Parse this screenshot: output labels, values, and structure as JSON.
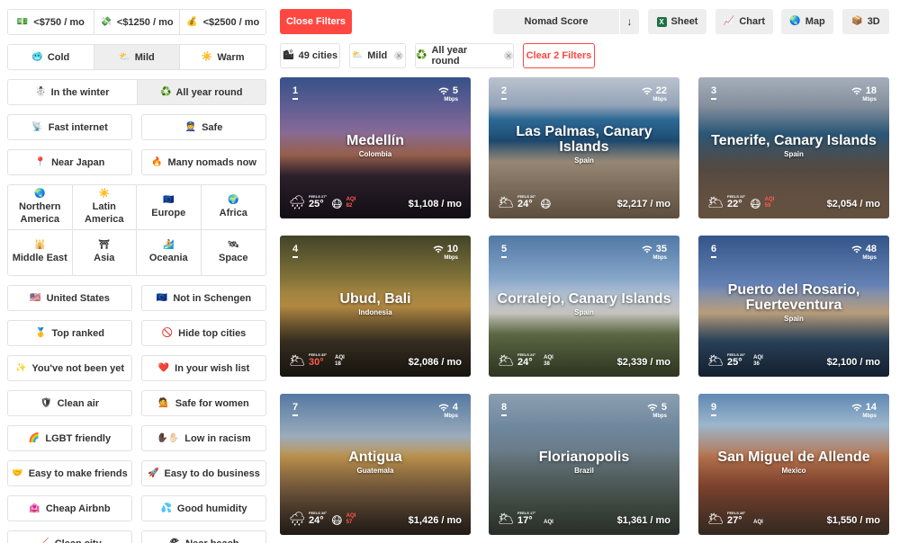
{
  "sidebar": {
    "budget": [
      {
        "icon": "💵",
        "label": "<$750 / mo"
      },
      {
        "icon": "💸",
        "label": "<$1250 / mo"
      },
      {
        "icon": "💰",
        "label": "<$2500 / mo"
      }
    ],
    "climate": [
      {
        "icon": "🥶",
        "label": "Cold"
      },
      {
        "icon": "⛅",
        "label": "Mild"
      },
      {
        "icon": "☀️",
        "label": "Warm"
      }
    ],
    "season": [
      {
        "icon": "☃️",
        "label": "In the winter"
      },
      {
        "icon": "♻️",
        "label": "All year round"
      }
    ],
    "toggles_a": [
      {
        "icon": "📡",
        "label": "Fast internet"
      },
      {
        "icon": "👮",
        "label": "Safe"
      },
      {
        "icon": "📍",
        "label": "Near Japan"
      },
      {
        "icon": "🔥",
        "label": "Many nomads now"
      }
    ],
    "regions": [
      {
        "icon": "🌏",
        "label": "Northern America"
      },
      {
        "icon": "☀️",
        "label": "Latin America"
      },
      {
        "icon": "🇪🇺",
        "label": "Europe"
      },
      {
        "icon": "🌍",
        "label": "Africa"
      },
      {
        "icon": "🕌",
        "label": "Middle East"
      },
      {
        "icon": "⛩",
        "label": "Asia"
      },
      {
        "icon": "🏄",
        "label": "Oceania"
      },
      {
        "icon": "🛰",
        "label": "Space"
      }
    ],
    "toggles_b": [
      {
        "icon": "🇺🇸",
        "label": "United States"
      },
      {
        "icon": "🇪🇺",
        "label": "Not in Schengen"
      },
      {
        "icon": "🥇",
        "label": "Top ranked"
      },
      {
        "icon": "🚫",
        "label": "Hide top cities"
      },
      {
        "icon": "✨",
        "label": "You've not been yet"
      },
      {
        "icon": "❤️",
        "label": "In your wish list"
      },
      {
        "icon": "🛡",
        "label": "Clean air"
      },
      {
        "icon": "💁",
        "label": "Safe for women"
      },
      {
        "icon": "🌈",
        "label": "LGBT friendly"
      },
      {
        "icon": "✋🏿✋🏻",
        "label": "Low in racism"
      },
      {
        "icon": "🤝",
        "label": "Easy to make friends"
      },
      {
        "icon": "🚀",
        "label": "Easy to do business"
      },
      {
        "icon": "🏩",
        "label": "Cheap Airbnb"
      },
      {
        "icon": "💦",
        "label": "Good humidity"
      },
      {
        "icon": "🧹",
        "label": "Clean city"
      },
      {
        "icon": "🏖",
        "label": "Near beach"
      }
    ]
  },
  "topbar": {
    "close_filters": "Close Filters",
    "sort_value": "Nomad Score",
    "sort_dir": "↓",
    "sheet": "Sheet",
    "chart": "Chart",
    "map": "Map",
    "three_d": "3D",
    "chart_icon": "📈",
    "map_icon": "🌏",
    "three_d_icon": "📦"
  },
  "active_filters": {
    "count": {
      "icon": "🏙",
      "label": "49 cities"
    },
    "mild": {
      "icon": "⛅",
      "label": "Mild"
    },
    "all_year": {
      "icon": "♻️",
      "label": "All year round"
    },
    "clear": "Clear 2 Filters"
  },
  "cities": [
    {
      "rank": "1",
      "name": "Medellín",
      "country": "Colombia",
      "speed": "5",
      "unit": "Mbps",
      "weather": "🌧",
      "feels": "FEELS 27°",
      "temp": "25°",
      "aqi_face": "😷",
      "aqi_label": "AQI",
      "aqi": "82",
      "aqi_bad": true,
      "temp_hot": false,
      "cost": "$1,108 / mo"
    },
    {
      "rank": "2",
      "name": "Las Palmas, Canary Islands",
      "country": "Spain",
      "speed": "22",
      "unit": "Mbps",
      "weather": "🌥",
      "feels": "FEELS 26°",
      "temp": "24°",
      "aqi_face": "😷",
      "aqi_label": "",
      "aqi": "",
      "aqi_bad": false,
      "temp_hot": false,
      "cost": "$2,217 / mo"
    },
    {
      "rank": "3",
      "name": "Tenerife, Canary Islands",
      "country": "Spain",
      "speed": "18",
      "unit": "Mbps",
      "weather": "🌥",
      "feels": "FEELS 23°",
      "temp": "22°",
      "aqi_face": "😷",
      "aqi_label": "AQI",
      "aqi": "59",
      "aqi_bad": true,
      "temp_hot": false,
      "cost": "$2,054 / mo"
    },
    {
      "rank": "4",
      "name": "Ubud, Bali",
      "country": "Indonesia",
      "speed": "10",
      "unit": "Mbps",
      "weather": "🌥",
      "feels": "FEELS 35°",
      "temp": "30°",
      "aqi_face": "",
      "aqi_label": "AQI",
      "aqi": "18",
      "aqi_bad": false,
      "temp_hot": true,
      "cost": "$2,086 / mo"
    },
    {
      "rank": "5",
      "name": "Corralejo, Canary Islands",
      "country": "Spain",
      "speed": "35",
      "unit": "Mbps",
      "weather": "🌥",
      "feels": "FEELS 24°",
      "temp": "24°",
      "aqi_face": "",
      "aqi_label": "AQI",
      "aqi": "38",
      "aqi_bad": false,
      "temp_hot": false,
      "cost": "$2,339 / mo"
    },
    {
      "rank": "6",
      "name": "Puerto del Rosario, Fuerteventura",
      "country": "Spain",
      "speed": "48",
      "unit": "Mbps",
      "weather": "🌥",
      "feels": "FEELS 26°",
      "temp": "25°",
      "aqi_face": "",
      "aqi_label": "AQI",
      "aqi": "36",
      "aqi_bad": false,
      "temp_hot": false,
      "cost": "$2,100 / mo"
    },
    {
      "rank": "7",
      "name": "Antigua",
      "country": "Guatemala",
      "speed": "4",
      "unit": "Mbps",
      "weather": "🌧",
      "feels": "FEELS 26°",
      "temp": "24°",
      "aqi_face": "😷",
      "aqi_label": "AQI",
      "aqi": "57",
      "aqi_bad": true,
      "temp_hot": false,
      "cost": "$1,426 / mo"
    },
    {
      "rank": "8",
      "name": "Florianopolis",
      "country": "Brazil",
      "speed": "5",
      "unit": "Mbps",
      "weather": "🌥",
      "feels": "FEELS 17°",
      "temp": "17°",
      "aqi_face": "",
      "aqi_label": "AQI",
      "aqi": "",
      "aqi_bad": false,
      "temp_hot": false,
      "cost": "$1,361 / mo"
    },
    {
      "rank": "9",
      "name": "San Miguel de Allende",
      "country": "Mexico",
      "speed": "14",
      "unit": "Mbps",
      "weather": "🌥",
      "feels": "FEELS 28°",
      "temp": "27°",
      "aqi_face": "",
      "aqi_label": "AQI",
      "aqi": "",
      "aqi_bad": false,
      "temp_hot": false,
      "cost": "$1,550 / mo"
    }
  ]
}
